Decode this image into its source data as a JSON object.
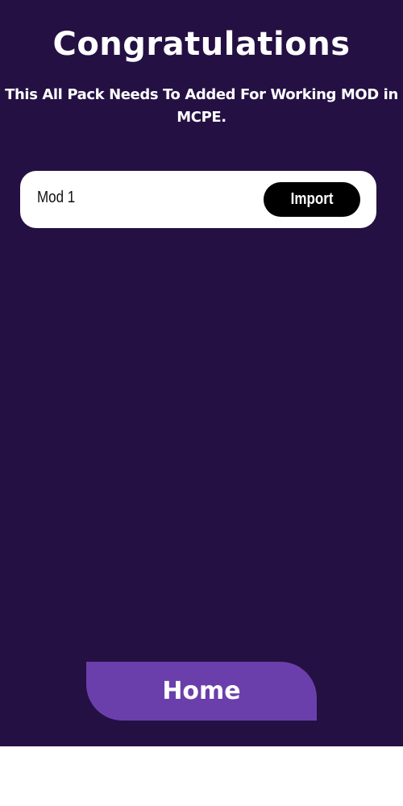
{
  "header": {
    "title": "Congratulations",
    "subtitle": "This All Pack Needs To Added For Working MOD in MCPE."
  },
  "mods": [
    {
      "name": "Mod 1",
      "action_label": "Import"
    }
  ],
  "footer": {
    "home_label": "Home"
  },
  "colors": {
    "background": "#241043",
    "home_button": "#6a3fab",
    "card": "#ffffff",
    "import_button": "#000000"
  }
}
